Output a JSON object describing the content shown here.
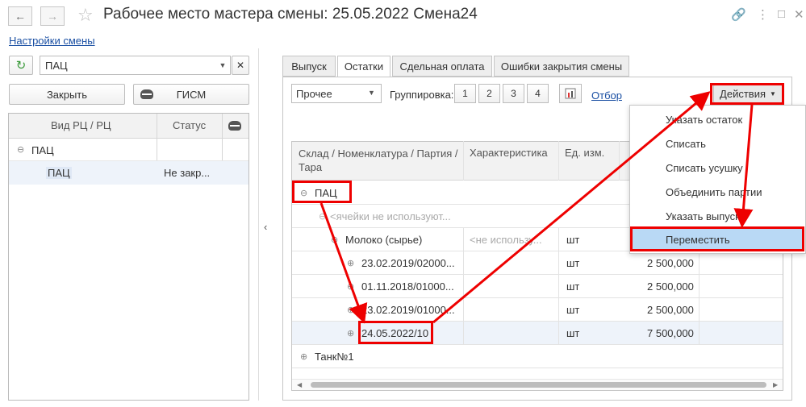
{
  "window": {
    "title": "Рабочее место мастера смены: 25.05.2022 Смена24",
    "settings_link": "Настройки смены"
  },
  "left": {
    "search_value": "ПАЦ",
    "close_button": "Закрыть",
    "gism_button": "ГИСМ",
    "columns": [
      "Вид РЦ / РЦ",
      "Статус"
    ],
    "rows": [
      {
        "name": "ПАЦ",
        "status": ""
      },
      {
        "name": "ПАЦ",
        "status": "Не закр..."
      }
    ]
  },
  "tabs": [
    "Выпуск",
    "Остатки",
    "Сдельная оплата",
    "Ошибки закрытия смены"
  ],
  "active_tab": "Остатки",
  "toolbar": {
    "filter_value": "Прочее",
    "grouping_label": "Группировка:",
    "group_buttons": [
      "1",
      "2",
      "3",
      "4"
    ],
    "selection_link": "Отбор",
    "actions_button": "Действия"
  },
  "table": {
    "columns": [
      "Склад / Номенклатура / Партия / Тара",
      "Характеристика",
      "Ед. изм."
    ],
    "rows": [
      {
        "name": "ПАЦ",
        "char": "",
        "unit": "",
        "qty": ""
      },
      {
        "name": "<ячейки не используют...",
        "char": "",
        "unit": "",
        "qty": ""
      },
      {
        "name": "Молоко (сырье)",
        "char": "<не использу...",
        "unit": "шт",
        "qty": ""
      },
      {
        "name": "23.02.2019/02000...",
        "char": "",
        "unit": "шт",
        "qty": "2 500,000"
      },
      {
        "name": "01.11.2018/01000...",
        "char": "",
        "unit": "шт",
        "qty": "2 500,000"
      },
      {
        "name": "23.02.2019/01000...",
        "char": "",
        "unit": "шт",
        "qty": "2 500,000"
      },
      {
        "name": "24.05.2022/10",
        "char": "",
        "unit": "шт",
        "qty": "7 500,000"
      },
      {
        "name": "Танк№1",
        "char": "",
        "unit": "",
        "qty": ""
      }
    ]
  },
  "menu": {
    "items": [
      "Указать остаток",
      "Списать",
      "Списать усушку",
      "Объединить партии",
      "Указать выпуск",
      "Переместить"
    ],
    "highlighted": "Переместить"
  },
  "colors": {
    "accent_red": "#e00000",
    "menu_highlight": "#b9d9f5",
    "link": "#1a4fa3"
  }
}
